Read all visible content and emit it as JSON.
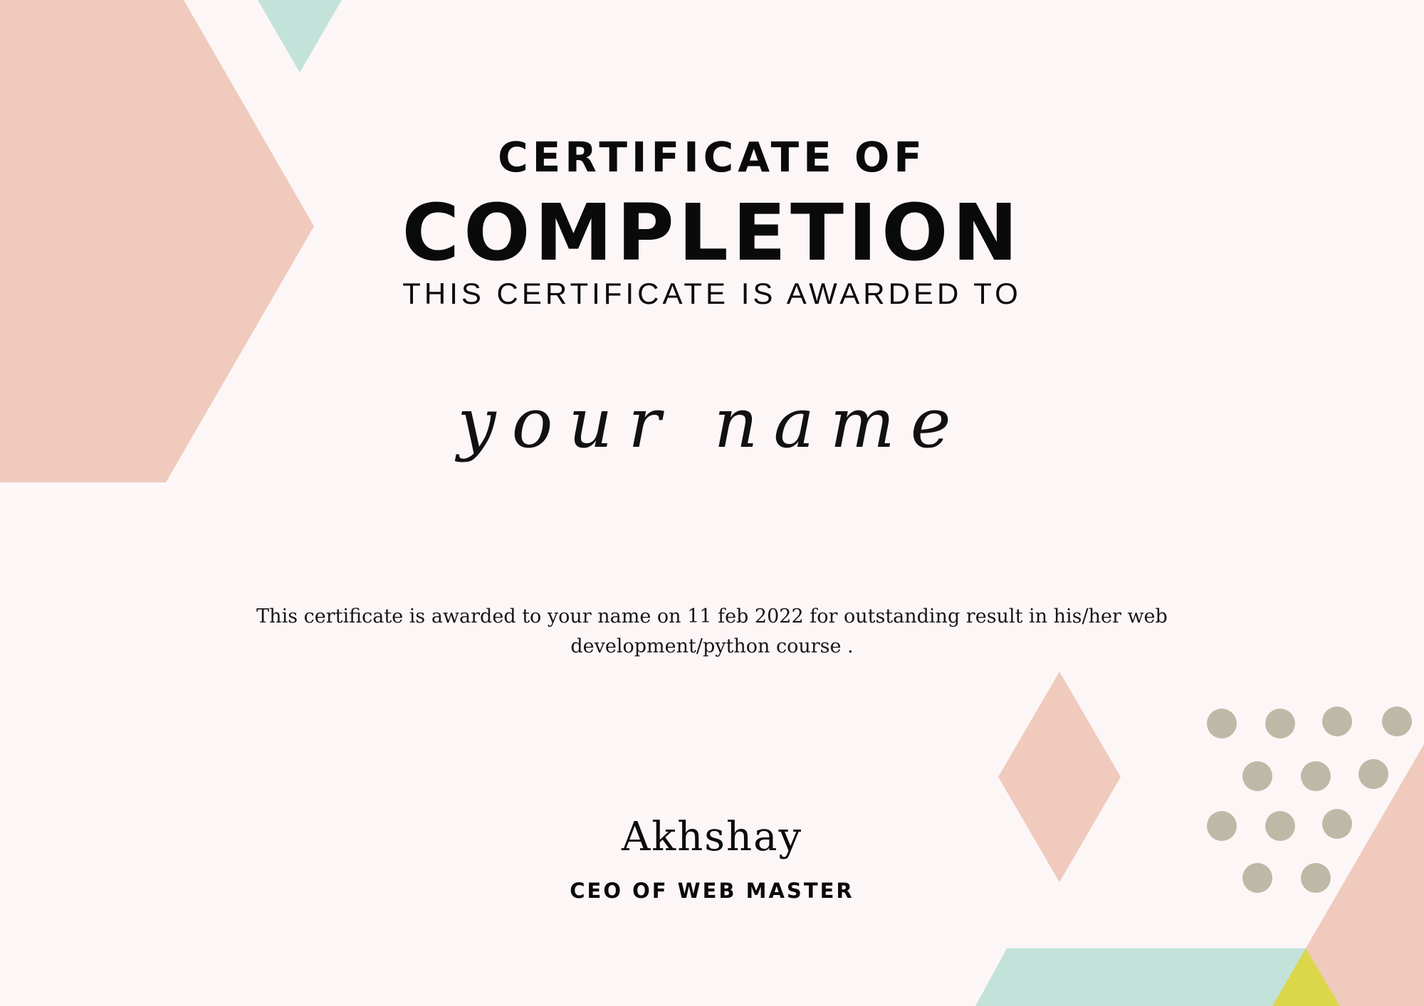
{
  "certificate": {
    "heading_top": "CERTIFICATE OF",
    "heading_main": "COMPLETION",
    "awarded_to_line": "THIS CERTIFICATE IS AWARDED TO",
    "recipient_name": "your name",
    "body_text": "This certificate is awarded to your name on 11 feb 2022 for outstanding result in his/her web development/python course .",
    "signer_name": "Akhshay",
    "signer_title": "CEO OF WEB MASTER"
  },
  "colors": {
    "background": "#fdf6f7",
    "peach": "#efcabd",
    "mint": "#c3e3da",
    "dots": "#bdb9a6",
    "yellow": "#dcd64a",
    "text": "#0a0a0a"
  }
}
